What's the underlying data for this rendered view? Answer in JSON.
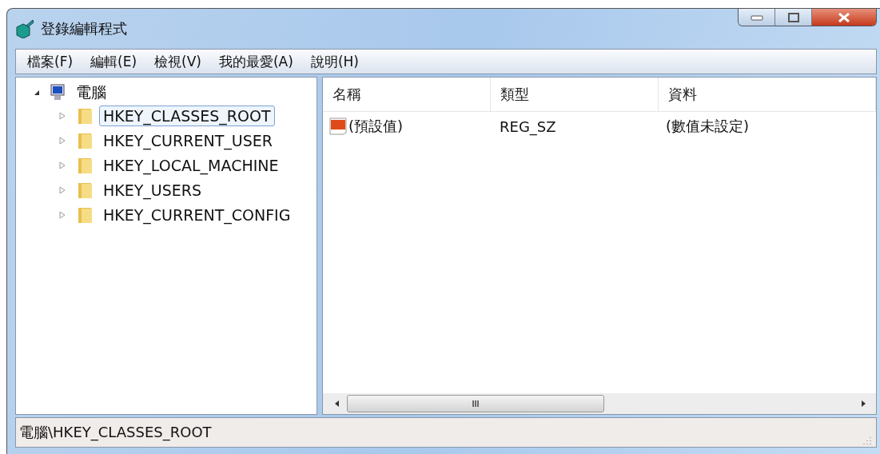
{
  "window": {
    "title": "登錄編輯程式"
  },
  "menu": [
    "檔案(F)",
    "編輯(E)",
    "檢視(V)",
    "我的最愛(A)",
    "說明(H)"
  ],
  "tree": {
    "label": "電腦",
    "expanded": true,
    "children": [
      {
        "label": "HKEY_CLASSES_ROOT",
        "selected": true,
        "expanded": false
      },
      {
        "label": "HKEY_CURRENT_USER",
        "selected": false,
        "expanded": false
      },
      {
        "label": "HKEY_LOCAL_MACHINE",
        "selected": false,
        "expanded": false
      },
      {
        "label": "HKEY_USERS",
        "selected": false,
        "expanded": false
      },
      {
        "label": "HKEY_CURRENT_CONFIG",
        "selected": false,
        "expanded": false
      }
    ]
  },
  "table": {
    "columns": [
      "名稱",
      "類型",
      "資料"
    ],
    "rows": [
      {
        "name": "(預設值)",
        "type": "REG_SZ",
        "data": "(數值未設定)"
      }
    ]
  },
  "status_bar": "電腦\\HKEY_CLASSES_ROOT"
}
